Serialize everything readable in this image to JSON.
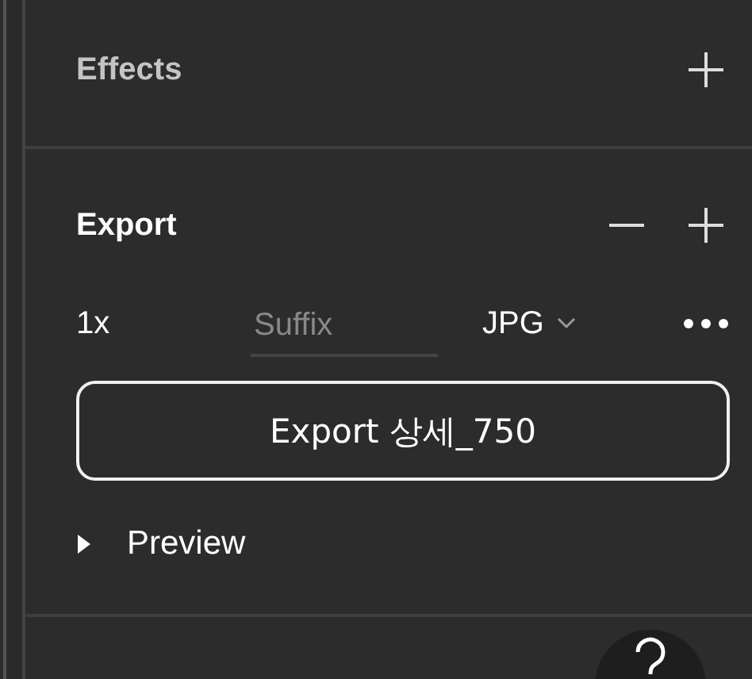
{
  "effects": {
    "title": "Effects",
    "active": false,
    "actions": [
      {
        "kind": "add"
      }
    ]
  },
  "export": {
    "title": "Export",
    "active": true,
    "actions": [
      {
        "kind": "remove"
      },
      {
        "kind": "add"
      }
    ],
    "setting": {
      "scale": "1x",
      "suffix": {
        "placeholder": "Suffix"
      },
      "format": "JPG"
    },
    "button": "Export 상세_750",
    "preview": {
      "label": "Preview",
      "expanded": false
    }
  }
}
